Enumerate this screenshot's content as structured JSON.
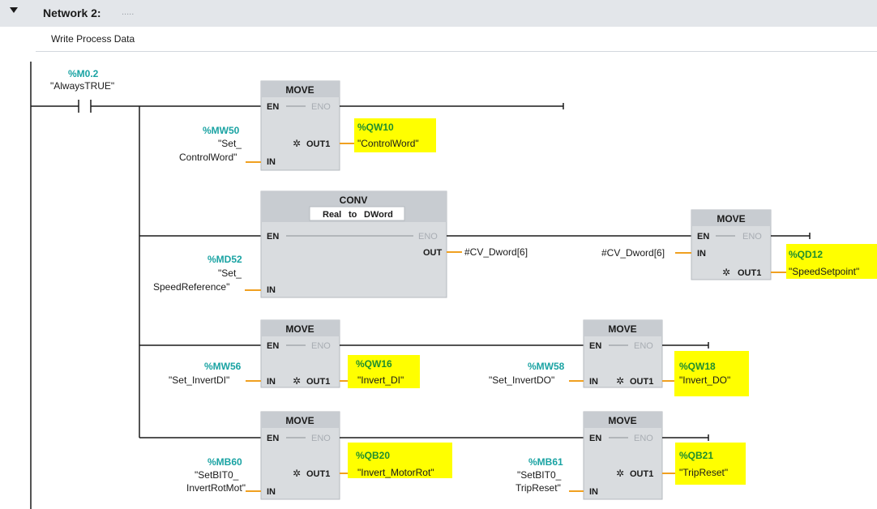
{
  "network": {
    "title": "Network 2:",
    "title_placeholder": ".....",
    "comment": "Write Process Data"
  },
  "contact": {
    "address": "%M0.2",
    "name": "\"AlwaysTRUE\""
  },
  "pins": {
    "en": "EN",
    "eno": "ENO",
    "in": "IN",
    "out": "OUT",
    "out1": "OUT1"
  },
  "blocks": {
    "move1": {
      "title": "MOVE",
      "in_addr": "%MW50",
      "in_name1": "\"Set_",
      "in_name2": "ControlWord\"",
      "out_addr": "%QW10",
      "out_name": "\"ControlWord\""
    },
    "conv": {
      "title": "CONV",
      "from": "Real",
      "to_word": "to",
      "to": "DWord",
      "in_addr": "%MD52",
      "in_name1": "\"Set_",
      "in_name2": "SpeedReference\"",
      "out_var": "#CV_Dword[6]"
    },
    "move2": {
      "title": "MOVE",
      "in_var": "#CV_Dword[6]",
      "out_addr": "%QD12",
      "out_name": "\"SpeedSetpoint\""
    },
    "move3": {
      "title": "MOVE",
      "in_addr": "%MW56",
      "in_name": "\"Set_InvertDI\"",
      "out_addr": "%QW16",
      "out_name": "\"Invert_DI\""
    },
    "move4": {
      "title": "MOVE",
      "in_addr": "%MW58",
      "in_name": "\"Set_InvertDO\"",
      "out_addr": "%QW18",
      "out_name": "\"Invert_DO\""
    },
    "move5": {
      "title": "MOVE",
      "in_addr": "%MB60",
      "in_name1": "\"SetBIT0_",
      "in_name2": "InvertRotMot\"",
      "out_addr": "%QB20",
      "out_name": "\"Invert_MotorRot\""
    },
    "move6": {
      "title": "MOVE",
      "in_addr": "%MB61",
      "in_name1": "\"SetBIT0_",
      "in_name2": "TripReset\"",
      "out_addr": "%QB21",
      "out_name": "\"TripReset\""
    }
  },
  "colors": {
    "header_bg": "#e3e6ea",
    "block_bg": "#d9dcdf",
    "block_title_bg": "#c8ccd1",
    "address": "#1aa3a3",
    "highlight": "#ffff00",
    "wire_in": "#f0a020"
  }
}
